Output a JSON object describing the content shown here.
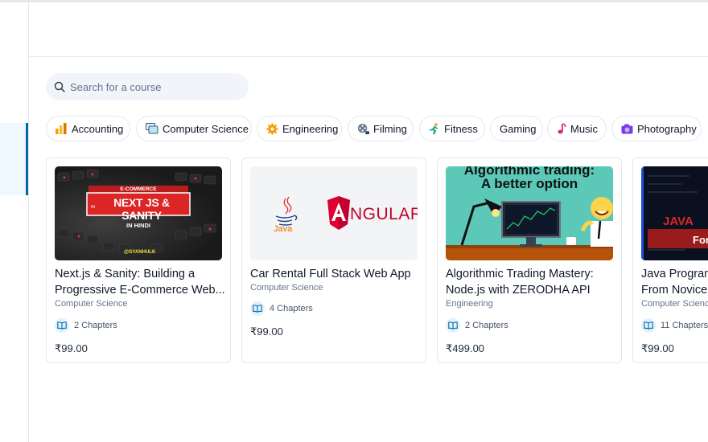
{
  "search": {
    "placeholder": "Search for a course"
  },
  "categories": [
    {
      "label": "Accounting",
      "icon": "bar-chart-icon"
    },
    {
      "label": "Computer Science",
      "icon": "computer-icon"
    },
    {
      "label": "Engineering",
      "icon": "gear-icon"
    },
    {
      "label": "Filming",
      "icon": "film-reel-icon"
    },
    {
      "label": "Fitness",
      "icon": "runner-icon"
    },
    {
      "label": "Gaming",
      "icon": ""
    },
    {
      "label": "Music",
      "icon": "music-note-icon"
    },
    {
      "label": "Photography",
      "icon": "camera-icon"
    }
  ],
  "courses": [
    {
      "title_line1": "Next.js & Sanity: Building a",
      "title_line2": "Progressive E-Commerce Web...",
      "category": "Computer Science",
      "chapters": "2 Chapters",
      "price": "₹99.00",
      "thumb": {
        "tag": "E-COMMERCE",
        "in": "IN",
        "banner": "NEXT JS & SANITY",
        "lang": "IN HINDI",
        "handle": "@GYANHULK"
      }
    },
    {
      "title_line1": "Car Rental Full Stack Web App",
      "title_line2": "",
      "category": "Computer Science",
      "chapters": "4 Chapters",
      "price": "₹99.00",
      "thumb": {
        "java": "Java",
        "angular": "NGULAR"
      }
    },
    {
      "title_line1": "Algorithmic Trading Mastery:",
      "title_line2": "Node.js with ZERODHA API",
      "category": "Engineering",
      "chapters": "2 Chapters",
      "price": "₹499.00",
      "thumb": {
        "line1": "Algorithmic trading:",
        "line2": "A better option"
      }
    },
    {
      "title_line1": "Java Program",
      "title_line2": "From Novice",
      "category": "Computer Science",
      "chapters": "11 Chapters",
      "price": "₹99.00",
      "thumb": {
        "text1": "JAVA",
        "text2": "For"
      }
    }
  ],
  "colors": {
    "accent": "#0369a1",
    "chip_border": "#e2e8f0",
    "search_bg": "#f1f5f9",
    "book_icon_bg": "#e0f2fe"
  }
}
